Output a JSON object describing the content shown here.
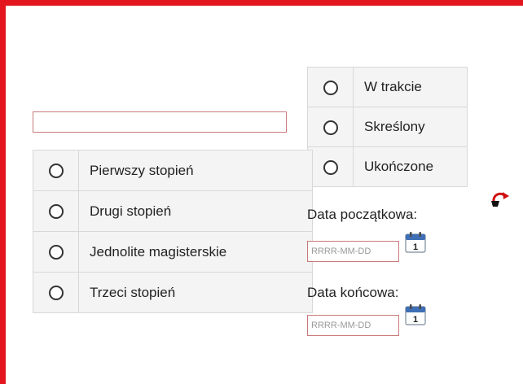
{
  "search": {
    "value": "",
    "placeholder": ""
  },
  "degree_options": [
    {
      "label": "Pierwszy stopień"
    },
    {
      "label": "Drugi stopień"
    },
    {
      "label": "Jednolite magisterskie"
    },
    {
      "label": "Trzeci stopień"
    }
  ],
  "status_options": [
    {
      "label": "W trakcie"
    },
    {
      "label": "Skreślony"
    },
    {
      "label": "Ukończone"
    }
  ],
  "start_date": {
    "label": "Data początkowa:",
    "placeholder": "RRRR-MM-DD",
    "calendar_icon_day": "1"
  },
  "end_date": {
    "label": "Data końcowa:",
    "placeholder": "RRRR-MM-DD",
    "calendar_icon_day": "1"
  },
  "icons": {
    "calendar": "calendar-icon",
    "reset": "undo-arrow-icon"
  },
  "colors": {
    "frame": "#e3151e",
    "input_border": "#c97a7a",
    "table_bg": "#f4f4f4",
    "undo_red": "#d01010"
  }
}
